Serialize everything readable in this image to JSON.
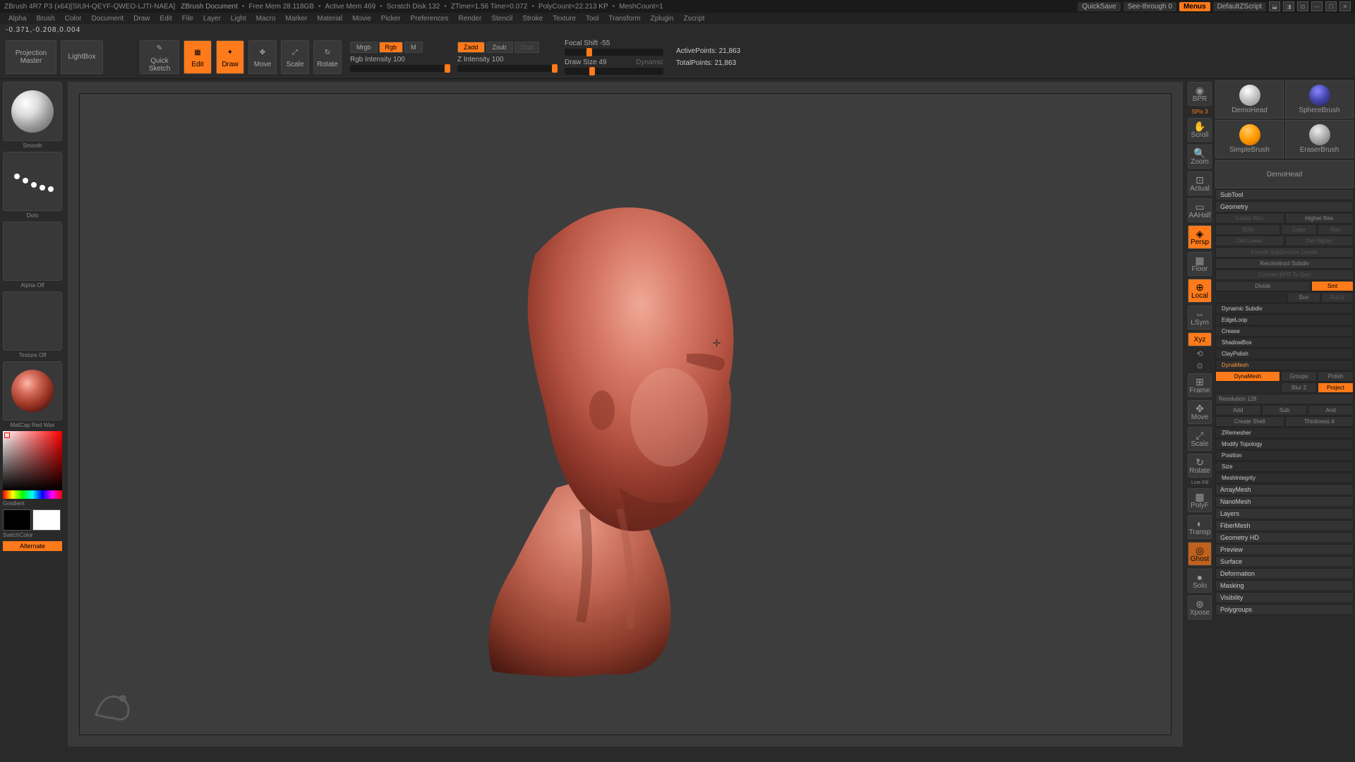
{
  "title": {
    "app": "ZBrush 4R7 P3 (x64)[SIUH-QEYF-QWEO-LJTI-NAEA]",
    "doc": "ZBrush Document",
    "freemem": "Free Mem 28.118GB",
    "activemem": "Active Mem 469",
    "scratch": "Scratch Disk 132",
    "ztime": "ZTime=1.56 Time=0.072",
    "polycount": "PolyCount=22.213 KP",
    "meshcount": "MeshCount=1",
    "quicksave": "QuickSave",
    "seethrough": "See-through  0",
    "menus": "Menus",
    "defaultz": "DefaultZScript"
  },
  "menu": [
    "Alpha",
    "Brush",
    "Color",
    "Document",
    "Draw",
    "Edit",
    "File",
    "Layer",
    "Light",
    "Macro",
    "Marker",
    "Material",
    "Movie",
    "Picker",
    "Preferences",
    "Render",
    "Stencil",
    "Stroke",
    "Texture",
    "Tool",
    "Transform",
    "Zplugin",
    "Zscript"
  ],
  "coords": "-0.371,-0.208,0.004",
  "shelf": {
    "projection": "Projection\nMaster",
    "lightbox": "LightBox",
    "quicksketch": "Quick\nSketch",
    "edit": "Edit",
    "draw": "Draw",
    "move": "Move",
    "scale": "Scale",
    "rotate": "Rotate",
    "mrgb": "Mrgb",
    "rgb": "Rgb",
    "m": "M",
    "rgbint": "Rgb Intensity 100",
    "zadd": "Zadd",
    "zsub": "Zsub",
    "zcut": "Zcut",
    "zint": "Z Intensity 100",
    "focalshift": "Focal Shift -55",
    "drawsize": "Draw Size 49",
    "dynamic": "Dynamic",
    "activepoints": "ActivePoints: 21,863",
    "totalpoints": "TotalPoints: 21,863"
  },
  "left": {
    "brush": "Smooth",
    "stroke": "Dots",
    "alpha": "Alpha Off",
    "texture": "Texture Off",
    "material": "MatCap Red Wax",
    "gradient": "Gradient",
    "switchcolor": "SwitchColor",
    "alternate": "Alternate"
  },
  "dock": {
    "bpr": "BPR",
    "spix": "SPix 3",
    "scroll": "Scroll",
    "zoom": "Zoom",
    "actual": "Actual",
    "aahalf": "AAHalf",
    "persp": "Persp",
    "floor": "Floor",
    "local": "Local",
    "lsym": "LSym",
    "xyz": "Xyz",
    "frame": "Frame",
    "movec": "Move",
    "scale": "Scale",
    "rotate": "Rotate",
    "linefill": "Line Fill",
    "polyf": "PolyF",
    "transp": "Transp",
    "ghost": "Ghost",
    "solo": "Solo",
    "xpose": "Xpose"
  },
  "tools": {
    "t1": "SimpleBrush",
    "t2": "SphereBrush",
    "t3": "DemoHead",
    "t4": "EraserBrush",
    "t5": "DemoHead"
  },
  "panel": {
    "subtool": "SubTool",
    "geometry": "Geometry",
    "lowerres": "Lower Res",
    "higherres": "Higher Res",
    "sdiv": "SDiv",
    "cage": "Cage",
    "ruv": "Ruv",
    "dellower": "Del Lower",
    "delhigher": "Del Higher",
    "freeze": "Freeze SubDivision Levels",
    "reconstruct": "Reconstruct Subdiv",
    "convert": "Convert BPR To Geo",
    "divide": "Divide",
    "smt": "Smt",
    "suv": "Suv",
    "ruv2": "RuUV",
    "dynsubdiv": "Dynamic Subdiv",
    "edgeloop": "EdgeLoop",
    "crease": "Crease",
    "shadowbox": "ShadowBox",
    "claypolish": "ClayPolish",
    "dynamesh": "DynaMesh",
    "dynameshbtn": "DynaMesh",
    "groups": "Groups",
    "polish": "Polish",
    "blur": "Blur 2",
    "project": "Project",
    "resolution": "Resolution 128",
    "add": "Add",
    "sub": "Sub",
    "and": "And",
    "createshell": "Create Shell",
    "thickness": "Thickness 4",
    "zremesher": "ZRemesher",
    "modifytopo": "Modify Topology",
    "position": "Position",
    "size": "Size",
    "meshintegrity": "MeshIntegrity",
    "arraymesh": "ArrayMesh",
    "nanomesh": "NanoMesh",
    "layers": "Layers",
    "fibermesh": "FiberMesh",
    "geometryhd": "Geometry HD",
    "preview": "Preview",
    "surface": "Surface",
    "deformation": "Deformation",
    "masking": "Masking",
    "visibility": "Visibility",
    "polygroups": "Polygroups"
  }
}
